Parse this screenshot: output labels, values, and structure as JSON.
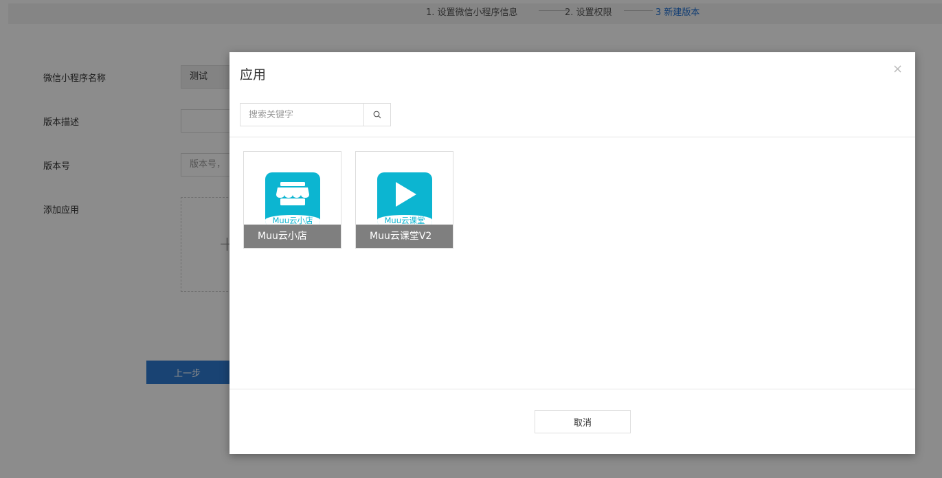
{
  "steps": [
    {
      "label": "1. 设置微信小程序信息"
    },
    {
      "label": "2. 设置权限"
    },
    {
      "label": "3 新建版本",
      "active": true
    }
  ],
  "form": {
    "name_label": "微信小程序名称",
    "name_value": "测试",
    "desc_label": "版本描述",
    "desc_value": "",
    "version_label": "版本号",
    "version_placeholder": "版本号，",
    "app_label": "添加应用",
    "add_symbol": "+",
    "prev_label": "上一步"
  },
  "modal": {
    "title": "应用",
    "close_symbol": "×",
    "search_placeholder": "搜索关键字",
    "apps": [
      {
        "icon_text": "Muu云小店",
        "name": "Muu云小店",
        "icon": "shop-icon"
      },
      {
        "icon_text": "Muu云课堂",
        "name": "Muu云课堂V2",
        "icon": "play-icon"
      }
    ],
    "cancel_label": "取消"
  },
  "colors": {
    "accent": "#2e7ad1",
    "active_step": "#1f6fd1",
    "app_icon_bg": "#0cb5d1",
    "name_bar_bg": "#7f7f7f"
  }
}
